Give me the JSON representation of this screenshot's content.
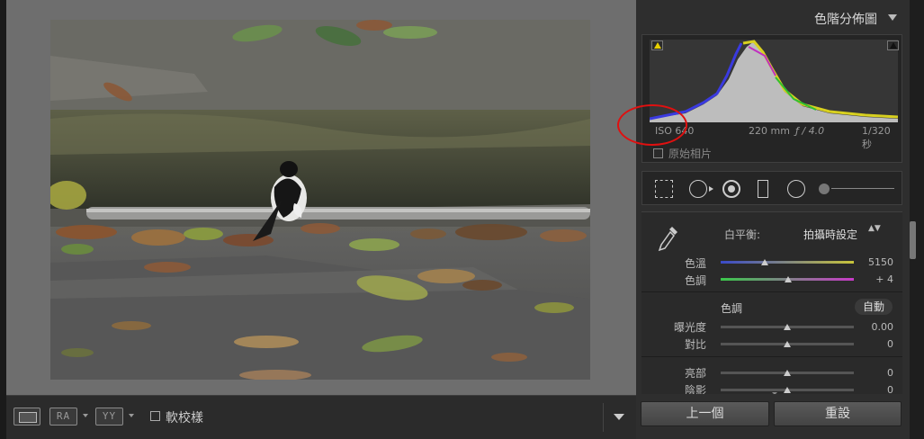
{
  "histogram": {
    "title": "色階分佈圖",
    "exif": {
      "iso": "ISO 640",
      "focal": "220 mm",
      "aperture": "ƒ / 4.0",
      "shutter": "1/320 秒"
    },
    "original_photo_label": "原始相片",
    "annotation_color": "#e01010"
  },
  "basic": {
    "wb_label": "白平衡:",
    "wb_value": "拍攝時設定",
    "wb_arrows": "▲▼",
    "temp": {
      "label": "色溫",
      "value": "5150",
      "level": 0.33
    },
    "tint": {
      "label": "色調",
      "value": "+ 4",
      "level": 0.51
    },
    "tone_title": "色調",
    "auto_label": "自動",
    "exposure": {
      "label": "曝光度",
      "value": "0.00",
      "level": 0.5
    },
    "contrast": {
      "label": "對比",
      "value": "0",
      "level": 0.5
    },
    "highlights": {
      "label": "亮部",
      "value": "0",
      "level": 0.5
    },
    "shadows": {
      "label": "陰影",
      "value": "0",
      "level": 0.5
    }
  },
  "toolbar": {
    "ra_label": "RA",
    "yy_label": "YY",
    "soft_proof_label": "軟校樣"
  },
  "buttons": {
    "previous": "上一個",
    "reset": "重設"
  },
  "colors": {
    "temp_gradient": [
      "#3a4ac8",
      "#c8c43a"
    ],
    "tint_gradient": [
      "#3ac84a",
      "#c83ac8"
    ]
  }
}
